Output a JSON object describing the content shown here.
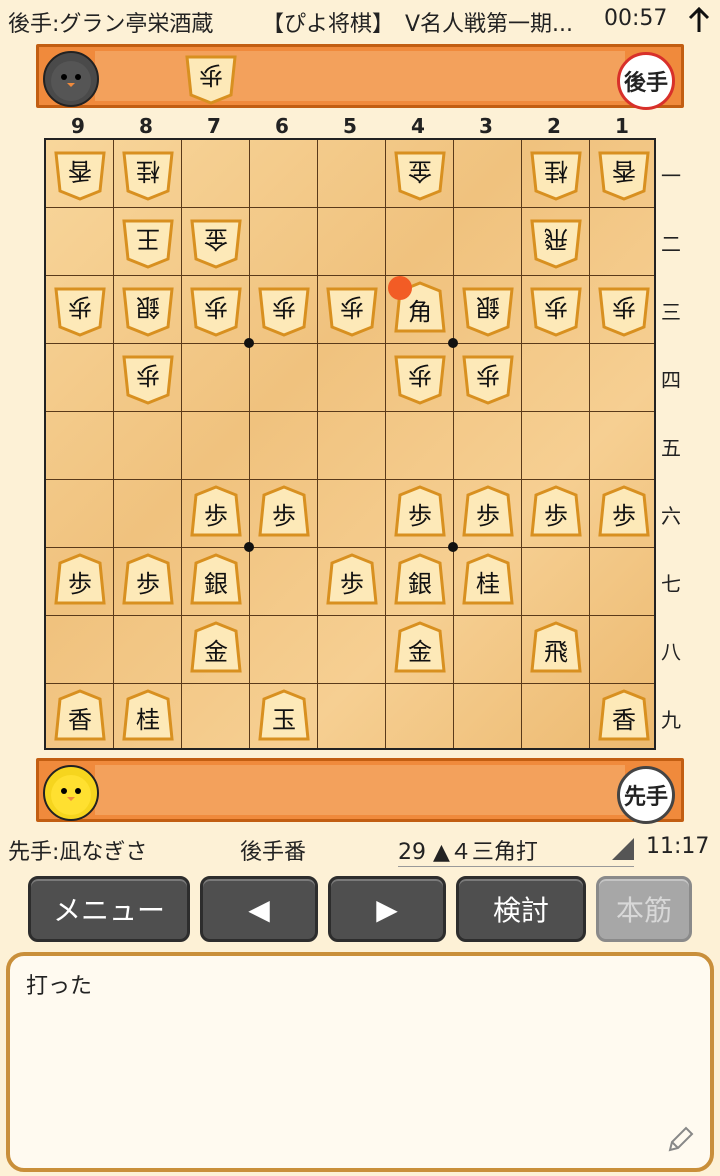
{
  "topbar": {
    "gote_player": "後手:グラン亭栄酒蔵",
    "event": "【ぴよ将棋】　V名人戦第一期...",
    "time": "00:57",
    "sort_icon": "up-arrow-icon"
  },
  "gote_tray": {
    "badge": "後手",
    "hand_pieces": [
      "歩"
    ]
  },
  "sente_tray": {
    "badge": "先手"
  },
  "board": {
    "columns": [
      "9",
      "8",
      "7",
      "6",
      "5",
      "4",
      "3",
      "2",
      "1"
    ],
    "rows": [
      "一",
      "二",
      "三",
      "四",
      "五",
      "六",
      "七",
      "八",
      "九"
    ],
    "pieces": [
      {
        "col": 9,
        "row": 1,
        "label": "香",
        "owner": "gote"
      },
      {
        "col": 8,
        "row": 1,
        "label": "桂",
        "owner": "gote"
      },
      {
        "col": 4,
        "row": 1,
        "label": "金",
        "owner": "gote"
      },
      {
        "col": 2,
        "row": 1,
        "label": "桂",
        "owner": "gote"
      },
      {
        "col": 1,
        "row": 1,
        "label": "香",
        "owner": "gote"
      },
      {
        "col": 8,
        "row": 2,
        "label": "王",
        "owner": "gote"
      },
      {
        "col": 7,
        "row": 2,
        "label": "金",
        "owner": "gote"
      },
      {
        "col": 2,
        "row": 2,
        "label": "飛",
        "owner": "gote"
      },
      {
        "col": 9,
        "row": 3,
        "label": "歩",
        "owner": "gote"
      },
      {
        "col": 8,
        "row": 3,
        "label": "銀",
        "owner": "gote"
      },
      {
        "col": 7,
        "row": 3,
        "label": "歩",
        "owner": "gote"
      },
      {
        "col": 6,
        "row": 3,
        "label": "歩",
        "owner": "gote"
      },
      {
        "col": 5,
        "row": 3,
        "label": "歩",
        "owner": "gote"
      },
      {
        "col": 4,
        "row": 3,
        "label": "角",
        "owner": "sente"
      },
      {
        "col": 3,
        "row": 3,
        "label": "銀",
        "owner": "gote"
      },
      {
        "col": 2,
        "row": 3,
        "label": "歩",
        "owner": "gote"
      },
      {
        "col": 1,
        "row": 3,
        "label": "歩",
        "owner": "gote"
      },
      {
        "col": 8,
        "row": 4,
        "label": "歩",
        "owner": "gote"
      },
      {
        "col": 4,
        "row": 4,
        "label": "歩",
        "owner": "gote"
      },
      {
        "col": 3,
        "row": 4,
        "label": "歩",
        "owner": "gote"
      },
      {
        "col": 7,
        "row": 6,
        "label": "歩",
        "owner": "sente"
      },
      {
        "col": 6,
        "row": 6,
        "label": "歩",
        "owner": "sente"
      },
      {
        "col": 4,
        "row": 6,
        "label": "歩",
        "owner": "sente"
      },
      {
        "col": 3,
        "row": 6,
        "label": "歩",
        "owner": "sente"
      },
      {
        "col": 2,
        "row": 6,
        "label": "歩",
        "owner": "sente"
      },
      {
        "col": 1,
        "row": 6,
        "label": "歩",
        "owner": "sente"
      },
      {
        "col": 9,
        "row": 7,
        "label": "歩",
        "owner": "sente"
      },
      {
        "col": 8,
        "row": 7,
        "label": "歩",
        "owner": "sente"
      },
      {
        "col": 7,
        "row": 7,
        "label": "銀",
        "owner": "sente"
      },
      {
        "col": 5,
        "row": 7,
        "label": "歩",
        "owner": "sente"
      },
      {
        "col": 4,
        "row": 7,
        "label": "銀",
        "owner": "sente"
      },
      {
        "col": 3,
        "row": 7,
        "label": "桂",
        "owner": "sente"
      },
      {
        "col": 7,
        "row": 8,
        "label": "金",
        "owner": "sente"
      },
      {
        "col": 4,
        "row": 8,
        "label": "金",
        "owner": "sente"
      },
      {
        "col": 2,
        "row": 8,
        "label": "飛",
        "owner": "sente"
      },
      {
        "col": 9,
        "row": 9,
        "label": "香",
        "owner": "sente"
      },
      {
        "col": 8,
        "row": 9,
        "label": "桂",
        "owner": "sente"
      },
      {
        "col": 6,
        "row": 9,
        "label": "玉",
        "owner": "sente"
      },
      {
        "col": 1,
        "row": 9,
        "label": "香",
        "owner": "sente"
      }
    ],
    "last_move_marker": {
      "col": 4,
      "row": 3
    }
  },
  "infobar": {
    "sente_player": "先手:凪なぎさ",
    "turn": "後手番",
    "move": "29 ▲４三角打",
    "time": "11:17"
  },
  "buttons": {
    "menu": "メニュー",
    "prev": "◀",
    "next": "▶",
    "analyze": "検討",
    "mainline": "本筋"
  },
  "comment": {
    "text": "打った",
    "edit_icon": "pencil-icon"
  },
  "colors": {
    "tray": "#f08a3c",
    "board": "#f4c98a",
    "button": "#4f4f4f",
    "marker": "#f25c25"
  }
}
